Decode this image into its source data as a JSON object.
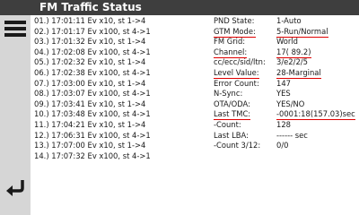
{
  "header": {
    "title": "FM Traffic Status"
  },
  "sidebar": {
    "menu_icon": "hamburger-menu-icon",
    "back_icon": "back-arrow-icon"
  },
  "events": [
    "01.) 17:01:11 Ev x10, st 1->4",
    "02.) 17:01:17 Ev x100, st 4->1",
    "03.) 17:01:32 Ev x10, st 1->4",
    "04.) 17:02:08 Ev x100, st 4->1",
    "05.) 17:02:32 Ev x10, st 1->4",
    "06.) 17:02:38 Ev x100, st 4->1",
    "07.) 17:03:00 Ev x10, st 1->4",
    "08.) 17:03:07 Ev x100, st 4->1",
    "09.) 17:03:41 Ev x10, st 1->4",
    "10.) 17:03:48 Ev x100, st 4->1",
    "11.) 17:04:21 Ev x10, st 1->4",
    "12.) 17:06:31 Ev x100, st 4->1",
    "13.) 17:07:00 Ev x10, st 1->4",
    "14.) 17:07:32 Ev x100, st 4->1"
  ],
  "status": [
    {
      "label": "PND State:",
      "value": "1-Auto"
    },
    {
      "label": "GTM Mode:",
      "value": "5-Run/Normal"
    },
    {
      "label": "FM Grid:",
      "value": "World"
    },
    {
      "label": "Channel:",
      "value": "17( 89.2)"
    },
    {
      "label": "cc/ecc/sid/ltn:",
      "value": "3/e2/2/5"
    },
    {
      "label": "Level Value:",
      "value": "28-Marginal"
    },
    {
      "label": "Error Count:",
      "value": "147"
    },
    {
      "label": "N-Sync:",
      "value": "YES"
    },
    {
      "label": "OTA/ODA:",
      "value": "YES/NO"
    },
    {
      "label": "Last TMC:",
      "value": "-0001:18(157.03)sec"
    },
    {
      "label": "-Count:",
      "value": "128"
    },
    {
      "label": "Last LBA:",
      "value": "------ sec"
    },
    {
      "label": "-Count 3/12:",
      "value": "0/0"
    }
  ],
  "colors": {
    "header_bg": "#3e3e3e",
    "sidebar_bg": "#d6d6d6",
    "highlight": "#e00000"
  }
}
